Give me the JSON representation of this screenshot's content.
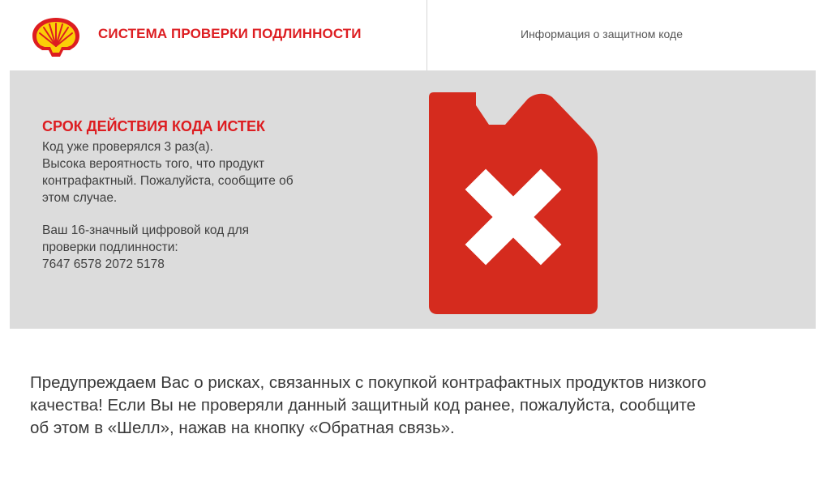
{
  "header": {
    "logo": "shell-logo",
    "title": "СИСТЕМА ПРОВЕРКИ ПОДЛИННОСТИ",
    "info_link": "Информация о защитном коде"
  },
  "result": {
    "title": "СРОК ДЕЙСТВИЯ КОДА ИСТЕК",
    "message_lines": [
      "Код уже проверялся 3 раз(а).",
      "Высока вероятность того, что продукт",
      "контрафактный. Пожалуйста, сообщите об",
      "этом случае."
    ],
    "code_lines": [
      "Ваш 16-значный цифровой код для",
      "проверки подлинности:",
      "7647 6578 2072 5178"
    ],
    "icon": "red-jerrycan-with-cross-icon"
  },
  "warning": {
    "lines": [
      "Предупреждаем Вас о рисках, связанных с покупкой контрафактных продуктов низкого",
      "качества! Если Вы не проверяли данный защитный код ранее, пожалуйста, сообщите",
      "об этом в «Шелл», нажав на кнопку «Обратная связь»."
    ]
  },
  "colors": {
    "brand_red": "#dd1d21",
    "brand_yellow": "#fbce07",
    "panel_bg": "#dcdcdc",
    "icon_red": "#d52b1e"
  }
}
